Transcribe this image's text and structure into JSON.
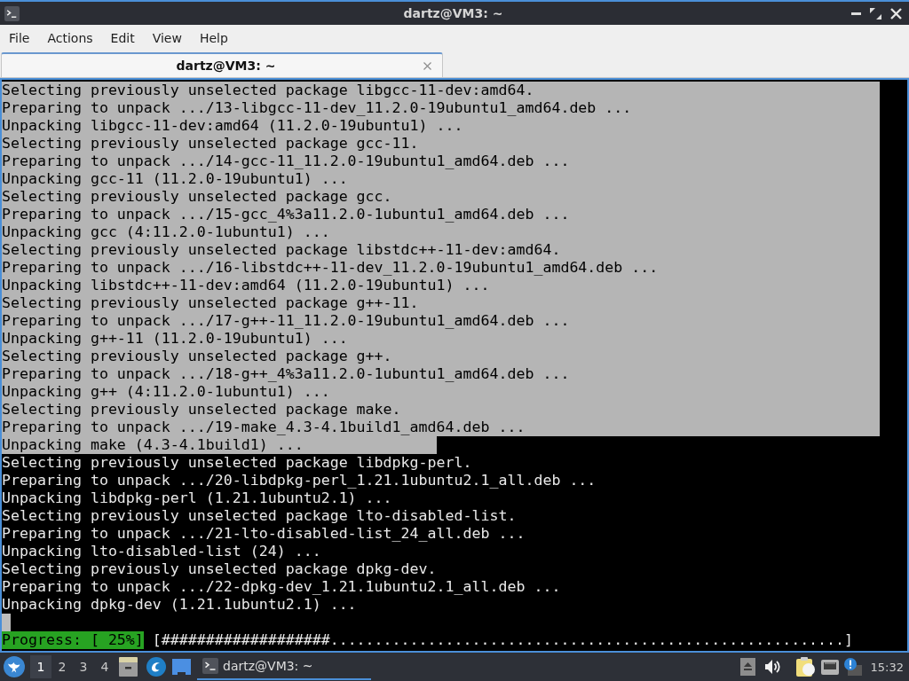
{
  "window": {
    "title": "dartz@VM3: ~"
  },
  "menu": [
    "File",
    "Actions",
    "Edit",
    "View",
    "Help"
  ],
  "tabs": [
    {
      "label": "dartz@VM3: ~",
      "selected": true
    }
  ],
  "terminal": {
    "lines": [
      {
        "text": "Selecting previously unselected package libgcc-11-dev:amd64.",
        "selected": true
      },
      {
        "text": "Preparing to unpack .../13-libgcc-11-dev_11.2.0-19ubuntu1_amd64.deb ...",
        "selected": true
      },
      {
        "text": "Unpacking libgcc-11-dev:amd64 (11.2.0-19ubuntu1) ...",
        "selected": true
      },
      {
        "text": "Selecting previously unselected package gcc-11.",
        "selected": true
      },
      {
        "text": "Preparing to unpack .../14-gcc-11_11.2.0-19ubuntu1_amd64.deb ...",
        "selected": true
      },
      {
        "text": "Unpacking gcc-11 (11.2.0-19ubuntu1) ...",
        "selected": true
      },
      {
        "text": "Selecting previously unselected package gcc.",
        "selected": true
      },
      {
        "text": "Preparing to unpack .../15-gcc_4%3a11.2.0-1ubuntu1_amd64.deb ...",
        "selected": true
      },
      {
        "text": "Unpacking gcc (4:11.2.0-1ubuntu1) ...",
        "selected": true
      },
      {
        "text": "Selecting previously unselected package libstdc++-11-dev:amd64.",
        "selected": true
      },
      {
        "text": "Preparing to unpack .../16-libstdc++-11-dev_11.2.0-19ubuntu1_amd64.deb ...",
        "selected": true
      },
      {
        "text": "Unpacking libstdc++-11-dev:amd64 (11.2.0-19ubuntu1) ...",
        "selected": true
      },
      {
        "text": "Selecting previously unselected package g++-11.",
        "selected": true
      },
      {
        "text": "Preparing to unpack .../17-g++-11_11.2.0-19ubuntu1_amd64.deb ...",
        "selected": true
      },
      {
        "text": "Unpacking g++-11 (11.2.0-19ubuntu1) ...",
        "selected": true
      },
      {
        "text": "Selecting previously unselected package g++.",
        "selected": true
      },
      {
        "text": "Preparing to unpack .../18-g++_4%3a11.2.0-1ubuntu1_amd64.deb ...",
        "selected": true
      },
      {
        "text": "Unpacking g++ (4:11.2.0-1ubuntu1) ...",
        "selected": true
      },
      {
        "text": "Selecting previously unselected package make.",
        "selected": true
      },
      {
        "text": "Preparing to unpack .../19-make_4.3-4.1build1_amd64.deb ...",
        "selected": true
      },
      {
        "text": "Unpacking make (4.3-4.1build1) ...",
        "selected": true,
        "partial": true
      },
      {
        "text": "Selecting previously unselected package libdpkg-perl.",
        "selected": false
      },
      {
        "text": "Preparing to unpack .../20-libdpkg-perl_1.21.1ubuntu2.1_all.deb ...",
        "selected": false
      },
      {
        "text": "Unpacking libdpkg-perl (1.21.1ubuntu2.1) ...",
        "selected": false
      },
      {
        "text": "Selecting previously unselected package lto-disabled-list.",
        "selected": false
      },
      {
        "text": "Preparing to unpack .../21-lto-disabled-list_24_all.deb ...",
        "selected": false
      },
      {
        "text": "Unpacking lto-disabled-list (24) ...",
        "selected": false
      },
      {
        "text": "Selecting previously unselected package dpkg-dev.",
        "selected": false
      },
      {
        "text": "Preparing to unpack .../22-dpkg-dev_1.21.1ubuntu2.1_all.deb ...",
        "selected": false
      },
      {
        "text": "Unpacking dpkg-dev (1.21.1ubuntu2.1) ...",
        "selected": false
      }
    ],
    "cursor_visible": true,
    "progress": {
      "label": "Progress: [ 25%]",
      "bar": "[###################..........................................................]"
    }
  },
  "taskbar": {
    "workspaces": [
      {
        "label": "1",
        "selected": true
      },
      {
        "label": "2",
        "selected": false
      },
      {
        "label": "3",
        "selected": false
      },
      {
        "label": "4",
        "selected": false
      }
    ],
    "tasks": [
      {
        "label": "dartz@VM3: ~",
        "selected": true
      }
    ],
    "clock": "15:32"
  }
}
